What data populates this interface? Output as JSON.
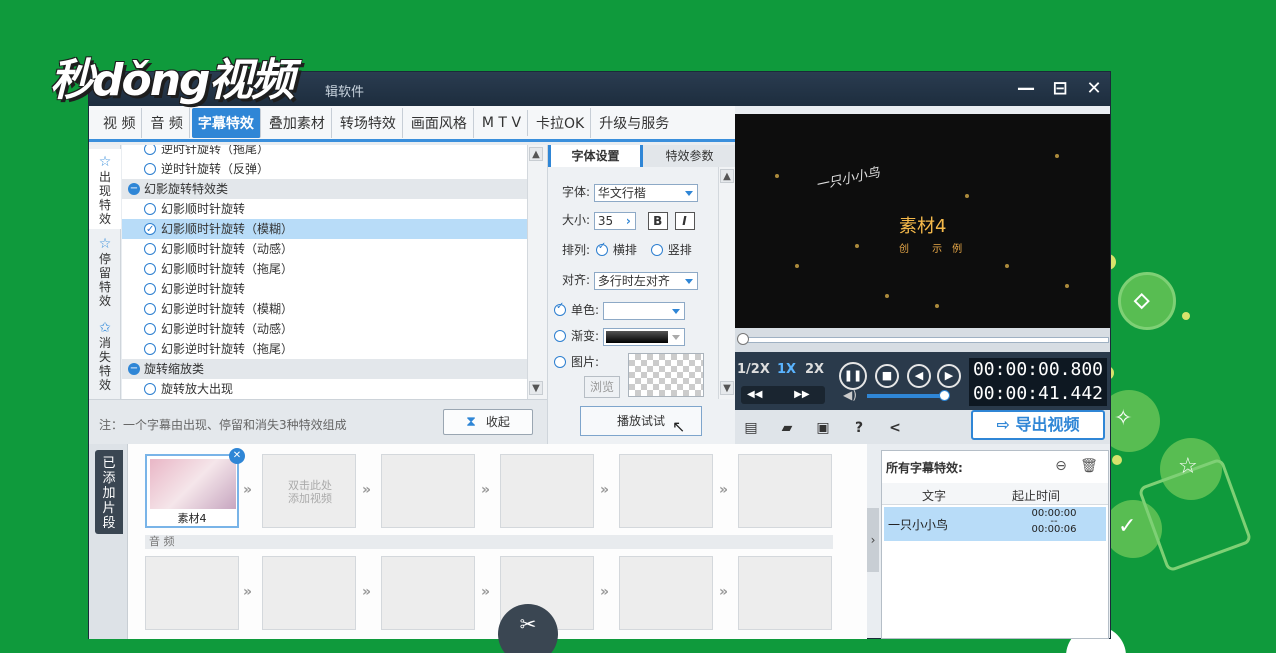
{
  "logo": "秒dǒng视频",
  "window": {
    "title_partial": "辑软件",
    "controls": [
      "—",
      "⊟",
      "✕"
    ]
  },
  "top_tabs": [
    {
      "label": "视 频",
      "active": false
    },
    {
      "label": "音 频",
      "active": false
    },
    {
      "label": "字幕特效",
      "active": true
    },
    {
      "label": "叠加素材",
      "active": false
    },
    {
      "label": "转场特效",
      "active": false
    },
    {
      "label": "画面风格",
      "active": false
    },
    {
      "label": "M T V",
      "active": false
    },
    {
      "label": "卡拉OK",
      "active": false
    },
    {
      "label": "升级与服务",
      "active": false
    }
  ],
  "side_tabs": [
    {
      "label": "出现特效",
      "active": true
    },
    {
      "label": "停留特效",
      "active": false
    },
    {
      "label": "消失特效",
      "active": false
    }
  ],
  "effects": [
    {
      "type": "item",
      "label": "逆时针旋转（拖尾）",
      "selected": false
    },
    {
      "type": "item",
      "label": "逆时针旋转（反弹）",
      "selected": false
    },
    {
      "type": "group",
      "label": "幻影旋转特效类"
    },
    {
      "type": "item",
      "label": "幻影顺时针旋转",
      "selected": false
    },
    {
      "type": "item",
      "label": "幻影顺时针旋转（模糊）",
      "selected": true
    },
    {
      "type": "item",
      "label": "幻影顺时针旋转（动感）",
      "selected": false
    },
    {
      "type": "item",
      "label": "幻影顺时针旋转（拖尾）",
      "selected": false
    },
    {
      "type": "item",
      "label": "幻影逆时针旋转",
      "selected": false
    },
    {
      "type": "item",
      "label": "幻影逆时针旋转（模糊）",
      "selected": false
    },
    {
      "type": "item",
      "label": "幻影逆时针旋转（动感）",
      "selected": false
    },
    {
      "type": "item",
      "label": "幻影逆时针旋转（拖尾）",
      "selected": false
    },
    {
      "type": "group",
      "label": "旋转缩放类"
    },
    {
      "type": "item",
      "label": "旋转放大出现",
      "selected": false
    }
  ],
  "note": "注：一个字幕由出现、停留和消失3种特效组成",
  "collapse_label": "收起",
  "font_panel": {
    "tabs": [
      "字体设置",
      "特效参数"
    ],
    "font_label": "字体:",
    "font_value": "华文行楷",
    "size_label": "大小:",
    "size_value": "35",
    "bold": "B",
    "italic": "I",
    "layout_label": "排列:",
    "layout_h": "横排",
    "layout_v": "竖排",
    "align_label": "对齐:",
    "align_value": "多行时左对齐",
    "solid_label": "单色:",
    "gradient_label": "渐变:",
    "image_label": "图片:",
    "browse": "浏览",
    "play_try": "播放试试"
  },
  "preview": {
    "line1": "一只小小鸟",
    "title": "素材4",
    "subtitle": "创 示例"
  },
  "player": {
    "speeds": [
      "1/2X",
      "1X",
      "2X"
    ],
    "active_speed": "1X",
    "time_current": "00:00:00.800",
    "time_total": "00:00:41.442"
  },
  "export_label": "导出视频",
  "clips": {
    "side_label": "已添加片段",
    "first_clip_name": "素材4",
    "empty_hint": "双击此处\n添加视频",
    "audio_label": "音 频"
  },
  "subtitle_effects": {
    "header": "所有字幕特效:",
    "col_text": "文字",
    "col_time": "起止时间",
    "rows": [
      {
        "text": "一只小小鸟",
        "start": "00:00:00",
        "sep": "--",
        "end": "00:00:06"
      }
    ]
  },
  "colors": {
    "background": "#0f9a3c",
    "accent": "#2f86d6",
    "selected_row": "#b8dcf8"
  }
}
